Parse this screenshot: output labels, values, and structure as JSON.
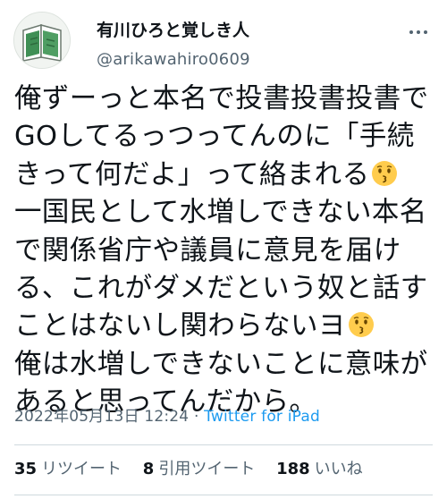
{
  "user": {
    "display_name": "有川ひろと覚しき人",
    "handle": "@arikawahiro0609"
  },
  "tweet": {
    "lines": [
      "俺ずーっと本名で投書投書投書で",
      "GOしてるっつってんのに「手続",
      "きって何だよ」って絡まれる",
      "一国民として水増しできない本名",
      "で関係省庁や議員に意見を届け",
      "る、これがダメだという奴と話す",
      "ことはないし関わらないヨ",
      "俺は水増しできないことに意味が",
      "あると思ってんだから。"
    ],
    "emoji": "kissing-face-emoji",
    "timestamp": "2022年05月13日 12:24",
    "separator": "·",
    "source": "Twitter for iPad"
  },
  "stats": {
    "retweets_count": "35",
    "retweets_label": "リツイート",
    "quotes_count": "8",
    "quotes_label": "引用ツイート",
    "likes_count": "188",
    "likes_label": "いいね"
  },
  "colors": {
    "text": "#0f1419",
    "secondary": "#536471",
    "link": "#1d9bf0",
    "divider": "#cfd9de"
  }
}
